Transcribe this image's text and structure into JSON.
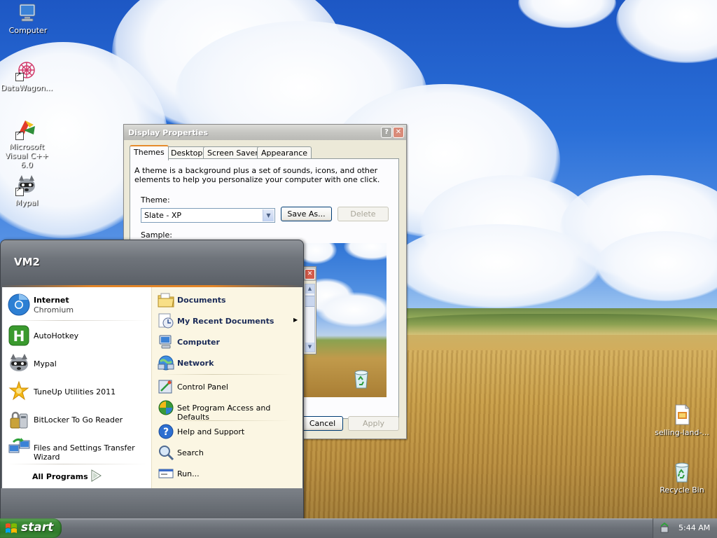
{
  "desktop": {
    "icons": [
      {
        "label": "Computer",
        "icon": "computer-icon"
      },
      {
        "label": "DataWagon...",
        "icon": "datawagon-icon"
      },
      {
        "label": "Microsoft Visual C++ 6.0",
        "icon": "visual-cpp-icon"
      },
      {
        "label": "Mypal",
        "icon": "mypal-raccoon-icon"
      },
      {
        "label": "selling-land-...",
        "icon": "html-document-icon"
      },
      {
        "label": "Recycle Bin",
        "icon": "recycle-bin-icon"
      }
    ]
  },
  "display_properties": {
    "title": "Display Properties",
    "tabs": [
      "Themes",
      "Desktop",
      "Screen Saver",
      "Appearance"
    ],
    "active_tab": "Themes",
    "description": "A theme is a background plus a set of sounds, icons, and other elements to help you personalize your computer with one click.",
    "theme_label": "Theme:",
    "theme_value": "Slate - XP",
    "save_as_label": "Save As...",
    "delete_label": "Delete",
    "sample_label": "Sample:",
    "cancel_label": "Cancel",
    "apply_label": "Apply"
  },
  "start_menu": {
    "user": "VM2",
    "pinned": [
      {
        "title": "Internet",
        "subtitle": "Chromium",
        "icon": "chromium-icon"
      }
    ],
    "recent": [
      {
        "title": "AutoHotkey",
        "icon": "autohotkey-icon"
      },
      {
        "title": "Mypal",
        "icon": "mypal-raccoon-icon"
      },
      {
        "title": "TuneUp Utilities 2011",
        "icon": "tuneup-icon"
      },
      {
        "title": "BitLocker To Go Reader",
        "icon": "bitlocker-icon"
      },
      {
        "title": "Files and Settings Transfer Wizard",
        "icon": "transfer-wizard-icon"
      }
    ],
    "all_programs": "All Programs",
    "right": [
      {
        "label": "Documents",
        "icon": "documents-folder-icon"
      },
      {
        "label": "My Recent Documents",
        "icon": "recent-documents-icon"
      },
      {
        "label": "Computer",
        "icon": "computer-icon"
      },
      {
        "label": "Network",
        "icon": "network-icon"
      },
      {
        "label": "Control Panel",
        "icon": "control-panel-icon"
      },
      {
        "label": "Set Program Access and Defaults",
        "icon": "program-access-icon"
      },
      {
        "label": "Help and Support",
        "icon": "help-icon"
      },
      {
        "label": "Search",
        "icon": "search-icon"
      },
      {
        "label": "Run...",
        "icon": "run-icon"
      }
    ]
  },
  "taskbar": {
    "start_label": "start",
    "clock": "5:44 AM"
  }
}
